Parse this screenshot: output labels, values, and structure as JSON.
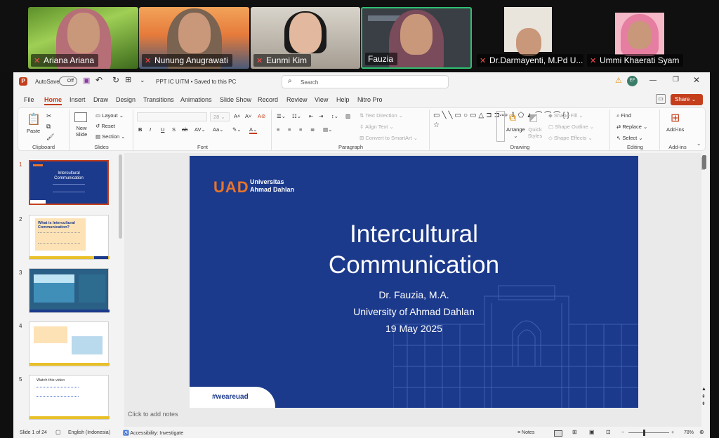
{
  "participants": [
    {
      "name": "Ariana Ariana"
    },
    {
      "name": "Nunung Anugrawati"
    },
    {
      "name": "Eunmi Kim"
    },
    {
      "name": "Fauzia"
    },
    {
      "name": "Dr.Darmayenti, M.Pd U..."
    },
    {
      "name": "Ummi Khaerati Syam"
    }
  ],
  "titlebar": {
    "autosave": "AutoSave",
    "autosave_state": "Off",
    "doc_title": "PPT IC UITM • Saved to this PC",
    "search_placeholder": "Search",
    "avatar_initials": "EF"
  },
  "tabs": [
    "File",
    "Home",
    "Insert",
    "Draw",
    "Design",
    "Transitions",
    "Animations",
    "Slide Show",
    "Record",
    "Review",
    "View",
    "Help",
    "Nitro Pro"
  ],
  "share_label": "Share",
  "ribbon": {
    "paste": "Paste",
    "new_slide": "New Slide",
    "layout": "Layout",
    "reset": "Reset",
    "section": "Section",
    "font_size": "28",
    "text_direction": "Text Direction",
    "align_text": "Align Text",
    "convert_smartart": "Convert to SmartArt",
    "arrange": "Arrange",
    "quick_styles": "Quick Styles",
    "shape_fill": "Shape Fill",
    "shape_outline": "Shape Outline",
    "shape_effects": "Shape Effects",
    "find": "Find",
    "replace": "Replace",
    "select": "Select",
    "addins": "Add-ins",
    "groups": {
      "clipboard": "Clipboard",
      "slides": "Slides",
      "font": "Font",
      "paragraph": "Paragraph",
      "drawing": "Drawing",
      "editing": "Editing",
      "addins": "Add-ins"
    }
  },
  "thumbnails": [
    {
      "num": "1",
      "text": "Intercultural Communication"
    },
    {
      "num": "2",
      "text": "What is Intercultural Communication?"
    },
    {
      "num": "3",
      "text": ""
    },
    {
      "num": "4",
      "text": ""
    },
    {
      "num": "5",
      "text": "Watch this video"
    }
  ],
  "slide": {
    "logo_uad": "UAD",
    "logo_line1": "Universitas",
    "logo_line2": "Ahmad Dahlan",
    "title_line1": "Intercultural",
    "title_line2": "Communication",
    "author": "Dr. Fauzia, M.A.",
    "affiliation": "University of Ahmad Dahlan",
    "date": "19 May 2025",
    "hashtag": "#weareuad"
  },
  "notes_placeholder": "Click to add notes",
  "statusbar": {
    "slide_info": "Slide 1 of 24",
    "language": "English (Indonesia)",
    "accessibility": "Accessibility: Investigate",
    "notes": "Notes",
    "zoom": "78%"
  },
  "colors": {
    "slide_bg": "#1c3a8c",
    "accent_orange": "#e8742a",
    "share_red": "#c43e1c",
    "active_speaker_green": "#2fbf71"
  }
}
